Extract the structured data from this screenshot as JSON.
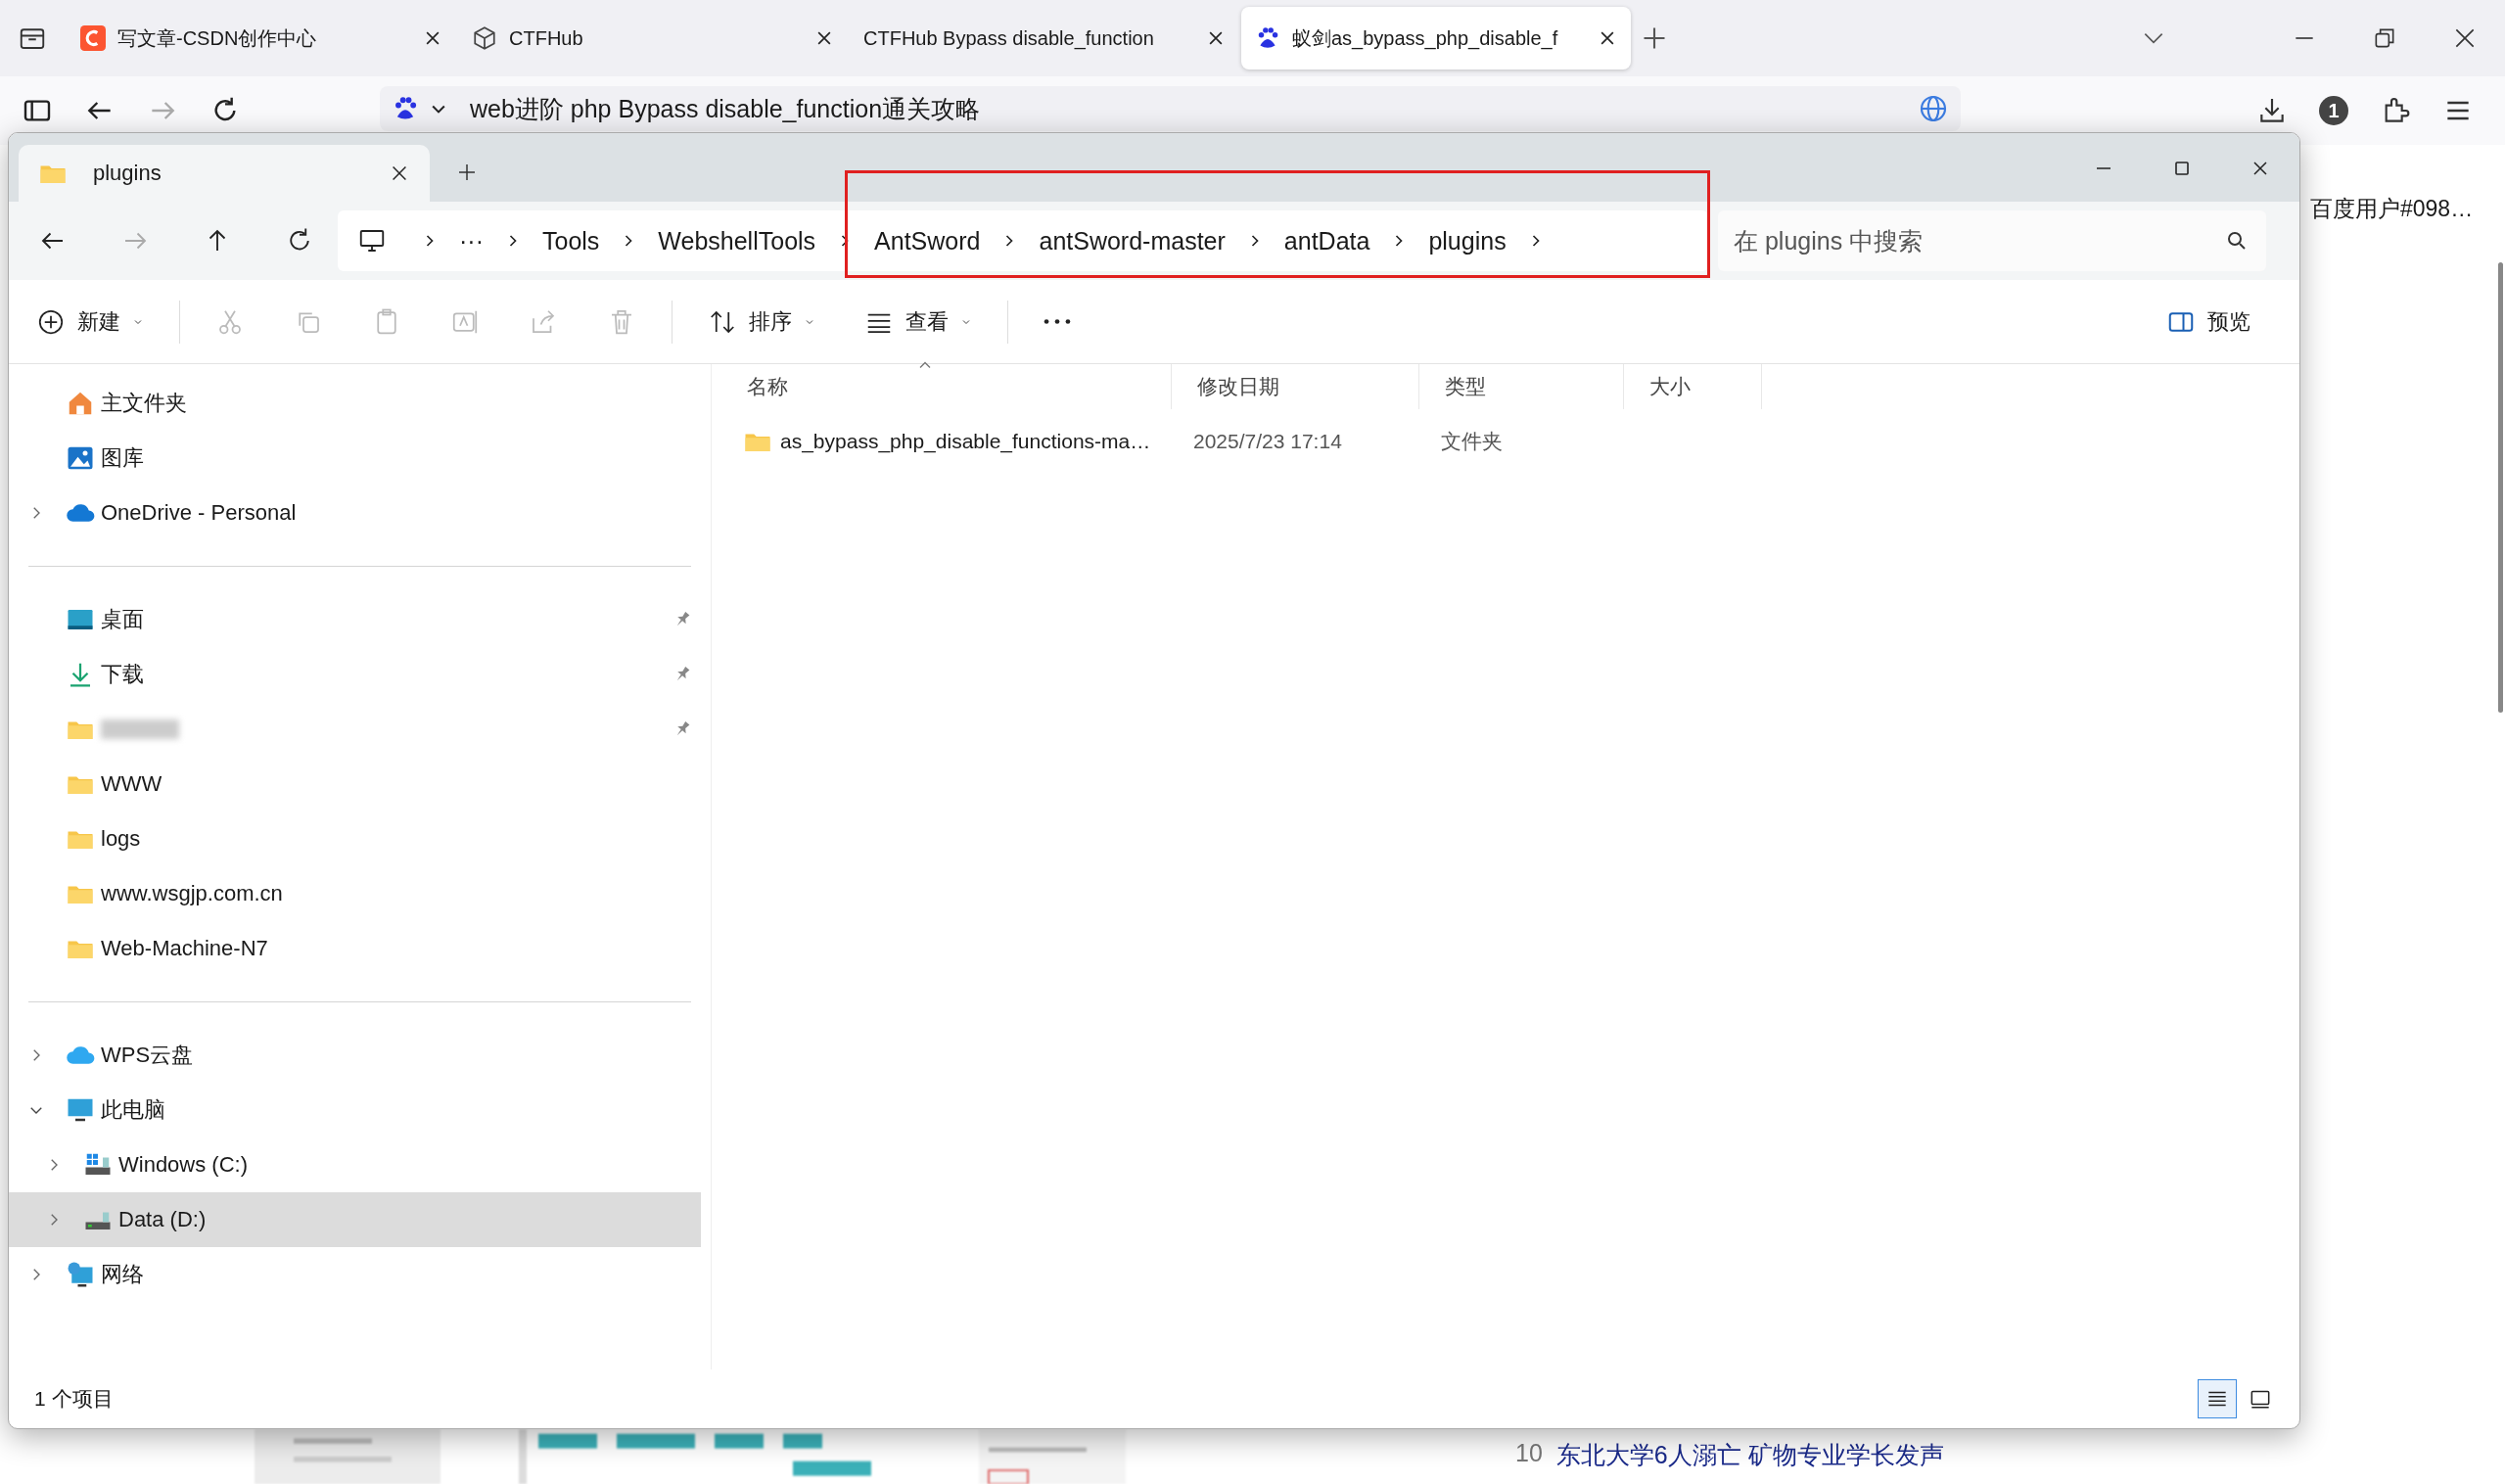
{
  "browser": {
    "tabs": [
      {
        "title": "写文章-CSDN创作中心",
        "kind": "csdn",
        "selected": false
      },
      {
        "title": "CTFHub",
        "kind": "hub",
        "selected": false
      },
      {
        "title": "CTFHub Bypass disable_function",
        "kind": "plain",
        "selected": false
      },
      {
        "title": "蚁剑as_bypass_php_disable_f",
        "kind": "paw",
        "selected": true
      }
    ],
    "address": "web进阶 php Bypass disable_function通关攻略",
    "account_badge": "1"
  },
  "page": {
    "user": "百度用户#098…",
    "headline_rank": "10",
    "headline": "东北大学6人溺亡 矿物专业学长发声"
  },
  "explorer": {
    "tab": "plugins",
    "path_overflow": "···",
    "path": [
      "Tools",
      "WebshellTools",
      "AntSword",
      "antSword-master",
      "antData",
      "plugins"
    ],
    "search": {
      "placeholder": "在 plugins 中搜索"
    },
    "commands": [
      {
        "kind": "new",
        "label": "新建",
        "disabled": false
      },
      {
        "kind": "cut",
        "disabled": true
      },
      {
        "kind": "copy",
        "disabled": true
      },
      {
        "kind": "paste",
        "disabled": true
      },
      {
        "kind": "rename",
        "disabled": true
      },
      {
        "kind": "share",
        "disabled": true
      },
      {
        "kind": "delete",
        "disabled": true
      },
      {
        "kind": "sort",
        "label": "排序",
        "disabled": false
      },
      {
        "kind": "view",
        "label": "查看",
        "disabled": false
      },
      {
        "kind": "more",
        "disabled": false
      }
    ],
    "preview": "预览",
    "sidebar": [
      [
        {
          "label": "主文件夹",
          "kind": "home",
          "selected": false
        },
        {
          "label": "图库",
          "kind": "gallery",
          "selected": false
        },
        {
          "label": "OneDrive - Personal",
          "kind": "cloud",
          "expanded": false,
          "selected": false
        }
      ],
      [
        {
          "label": "桌面",
          "kind": "desktop",
          "pinned": true,
          "selected": false
        },
        {
          "label": "下载",
          "kind": "download",
          "pinned": true,
          "selected": false
        },
        {
          "kind": "folder",
          "blurred": true,
          "pinned": true,
          "selected": false
        },
        {
          "label": "WWW",
          "kind": "folder",
          "pinned": false,
          "selected": false
        },
        {
          "label": "logs",
          "kind": "folder",
          "pinned": false,
          "selected": false
        },
        {
          "label": "www.wsgjp.com.cn",
          "kind": "folder",
          "pinned": false,
          "selected": false
        },
        {
          "label": "Web-Machine-N7",
          "kind": "folder",
          "pinned": false,
          "selected": false
        }
      ],
      [
        {
          "label": "WPS云盘",
          "kind": "wps",
          "expanded": false,
          "selected": false
        },
        {
          "label": "此电脑",
          "kind": "pc",
          "expanded": true,
          "selected": false,
          "children": [
            {
              "label": "Windows (C:)",
              "kind": "drive-win",
              "expanded": false,
              "selected": false
            },
            {
              "label": "Data (D:)",
              "kind": "drive",
              "expanded": false,
              "selected": true
            }
          ]
        },
        {
          "label": "网络",
          "kind": "network",
          "expanded": false,
          "selected": false
        }
      ]
    ],
    "columns": [
      {
        "label": "名称",
        "sorted": true
      },
      {
        "label": "修改日期",
        "sorted": false
      },
      {
        "label": "类型",
        "sorted": false
      },
      {
        "label": "大小",
        "sorted": false
      }
    ],
    "files": [
      {
        "name": "as_bypass_php_disable_functions-ma…",
        "modified": "2025/7/23 17:14",
        "type": "文件夹"
      }
    ],
    "status": "1 个项目",
    "views": [
      {
        "kind": "details",
        "selected": true
      },
      {
        "kind": "tiles",
        "selected": false
      }
    ],
    "highlight": true
  }
}
